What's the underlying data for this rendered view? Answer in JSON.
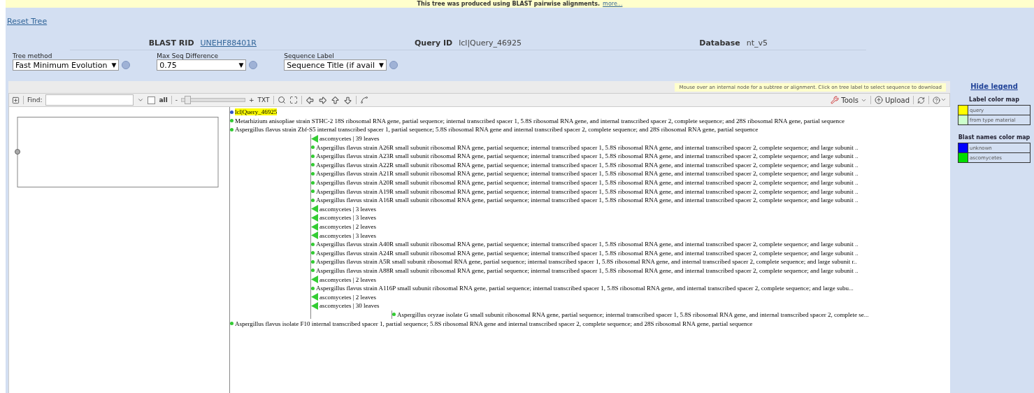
{
  "banner": {
    "text": "This tree was produced using BLAST pairwise alignments.",
    "link": "more..."
  },
  "reset_link": "Reset Tree",
  "info": [
    {
      "label": "BLAST RID",
      "value": "UNEHF88401R",
      "kind": "link"
    },
    {
      "label": "Query ID",
      "value": "lcl|Query_46925",
      "kind": "text"
    },
    {
      "label": "Database",
      "value": "nt_v5",
      "kind": "text"
    }
  ],
  "options": [
    {
      "label": "Tree method",
      "value": "Fast Minimum Evolution",
      "caret": "▼"
    },
    {
      "label": "Max Seq Difference",
      "value": "0.75",
      "caret": "▼"
    },
    {
      "label": "Sequence Label",
      "value": "Sequence Title (if avail",
      "caret": "▼"
    }
  ],
  "hint": "Mouse over an internal node for a subtree or alignment. Click on tree label to select sequence to download",
  "hide_legend": "Hide legend",
  "toolbar": {
    "find_label": "Find:",
    "all_label": "all",
    "all_checked": false,
    "minus": "-",
    "plus": "+",
    "zoom": {
      "level": 0.05
    },
    "txt": "TXT",
    "tools": "Tools",
    "upload": "Upload"
  },
  "legend": [
    {
      "title": "Label color map",
      "items": [
        {
          "label": "query",
          "color": "#ffff00"
        },
        {
          "label": "from type material",
          "color": "#ccffcc"
        }
      ]
    },
    {
      "title": "Blast names color map",
      "items": [
        {
          "label": "unknown",
          "color": "#0000ff"
        },
        {
          "label": "ascomycetes",
          "color": "#00dd00"
        }
      ]
    }
  ],
  "tree": {
    "children": [
      {
        "kind": "query",
        "label": "lcl|Query_46925",
        "color": "#3355cc"
      },
      {
        "kind": "leaf",
        "label": "Metarhizium anisopliae strain STHC-2 18S ribosomal RNA gene, partial sequence; internal transcribed spacer 1, 5.8S ribosomal RNA gene, and internal transcribed spacer 2, complete sequence; and 28S ribosomal RNA gene, partial sequence",
        "color": "#33cc33"
      },
      {
        "kind": "leaf",
        "label": "Aspergillus flavus strain Zbf-S5 internal transcribed spacer 1, partial sequence; 5.8S ribosomal RNA gene and internal transcribed spacer 2, complete sequence; and 28S ribosomal RNA gene, partial sequence",
        "color": "#33cc33"
      },
      {
        "children": [
          {
            "kind": "collapsed",
            "label": "ascomycetes | 39 leaves",
            "color": "#33cc33"
          },
          {
            "kind": "leaf",
            "label": "Aspergillus flavus strain A26R small subunit ribosomal RNA gene, partial sequence; internal transcribed spacer 1, 5.8S ribosomal RNA gene, and internal transcribed spacer 2, complete sequence; and large subunit ..",
            "color": "#33cc33"
          },
          {
            "kind": "leaf",
            "label": "Aspergillus flavus strain A23R small subunit ribosomal RNA gene, partial sequence; internal transcribed spacer 1, 5.8S ribosomal RNA gene, and internal transcribed spacer 2, complete sequence; and large subunit ..",
            "color": "#33cc33"
          },
          {
            "kind": "leaf",
            "label": "Aspergillus flavus strain A22R small subunit ribosomal RNA gene, partial sequence; internal transcribed spacer 1, 5.8S ribosomal RNA gene, and internal transcribed spacer 2, complete sequence; and large subunit ..",
            "color": "#33cc33"
          },
          {
            "kind": "leaf",
            "label": "Aspergillus flavus strain A21R small subunit ribosomal RNA gene, partial sequence; internal transcribed spacer 1, 5.8S ribosomal RNA gene, and internal transcribed spacer 2, complete sequence; and large subunit ..",
            "color": "#33cc33"
          },
          {
            "kind": "leaf",
            "label": "Aspergillus flavus strain A20R small subunit ribosomal RNA gene, partial sequence; internal transcribed spacer 1, 5.8S ribosomal RNA gene, and internal transcribed spacer 2, complete sequence; and large subunit ..",
            "color": "#33cc33"
          },
          {
            "kind": "leaf",
            "label": "Aspergillus flavus strain A19R small subunit ribosomal RNA gene, partial sequence; internal transcribed spacer 1, 5.8S ribosomal RNA gene, and internal transcribed spacer 2, complete sequence; and large subunit ..",
            "color": "#33cc33"
          },
          {
            "kind": "leaf",
            "label": "Aspergillus flavus strain A16R small subunit ribosomal RNA gene, partial sequence; internal transcribed spacer 1, 5.8S ribosomal RNA gene, and internal transcribed spacer 2, complete sequence; and large subunit ..",
            "color": "#33cc33"
          },
          {
            "kind": "collapsed",
            "label": "ascomycetes | 3 leaves",
            "color": "#33cc33"
          },
          {
            "kind": "collapsed",
            "label": "ascomycetes | 3 leaves",
            "color": "#33cc33"
          },
          {
            "kind": "collapsed",
            "label": "ascomycetes | 2 leaves",
            "color": "#33cc33"
          },
          {
            "kind": "collapsed",
            "label": "ascomycetes | 3 leaves",
            "color": "#33cc33"
          },
          {
            "kind": "leaf",
            "label": "Aspergillus flavus strain A40R small subunit ribosomal RNA gene, partial sequence; internal transcribed spacer 1, 5.8S ribosomal RNA gene, and internal transcribed spacer 2, complete sequence; and large subunit ..",
            "color": "#33cc33"
          },
          {
            "kind": "leaf",
            "label": "Aspergillus flavus strain A24R small subunit ribosomal RNA gene, partial sequence; internal transcribed spacer 1, 5.8S ribosomal RNA gene, and internal transcribed spacer 2, complete sequence; and large subunit ..",
            "color": "#33cc33"
          },
          {
            "kind": "leaf",
            "label": "Aspergillus flavus strain A5R small subunit ribosomal RNA gene, partial sequence; internal transcribed spacer 1, 5.8S ribosomal RNA gene, and internal transcribed spacer 2, complete sequence; and large subunit r..",
            "color": "#33cc33"
          },
          {
            "kind": "leaf",
            "label": "Aspergillus flavus strain A88R small subunit ribosomal RNA gene, partial sequence; internal transcribed spacer 1, 5.8S ribosomal RNA gene, and internal transcribed spacer 2, complete sequence; and large subunit ..",
            "color": "#33cc33"
          },
          {
            "kind": "collapsed",
            "label": "ascomycetes | 2 leaves",
            "color": "#33cc33"
          },
          {
            "kind": "leaf",
            "label": "Aspergillus flavus strain A116P small subunit ribosomal RNA gene, partial sequence; internal transcribed spacer 1, 5.8S ribosomal RNA gene, and internal transcribed spacer 2, complete sequence; and large subu...",
            "color": "#33cc33"
          },
          {
            "kind": "collapsed",
            "label": "ascomycetes | 2 leaves",
            "color": "#33cc33"
          },
          {
            "kind": "collapsed",
            "label": "ascomycetes | 30 leaves",
            "color": "#33cc33"
          }
        ]
      },
      {
        "children": [
          {
            "children": [
              {
                "kind": "leaf",
                "label": "Aspergillus oryzae isolate G small subunit ribosomal RNA gene, partial sequence; internal transcribed spacer 1, 5.8S ribosomal RNA gene, and internal transcribed spacer 2, complete se...",
                "color": "#33cc33"
              }
            ]
          }
        ]
      },
      {
        "kind": "leaf",
        "label": "Aspergillus flavus isolate F10 internal transcribed spacer 1, partial sequence; 5.8S ribosomal RNA gene and internal transcribed spacer 2, complete sequence; and 28S ribosomal RNA gene, partial sequence",
        "color": "#33cc33"
      }
    ]
  }
}
